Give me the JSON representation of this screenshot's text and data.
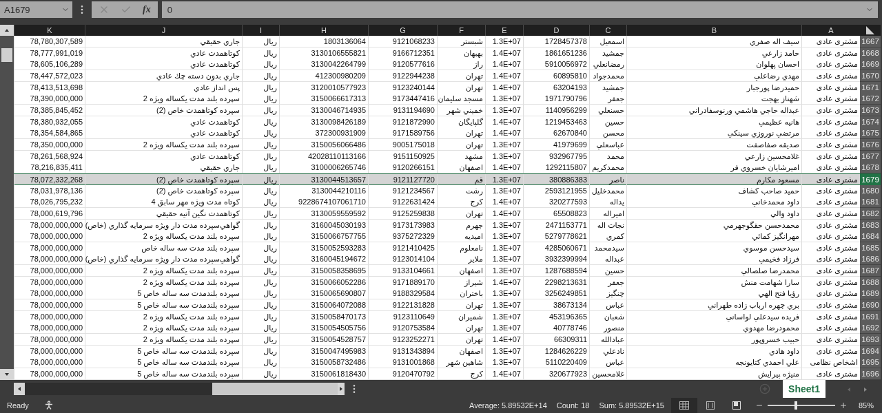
{
  "name_box": "A1679",
  "formula_bar": {
    "function_label": "fx",
    "value": "0"
  },
  "columns": [
    "A",
    "B",
    "C",
    "D",
    "E",
    "F",
    "G",
    "H",
    "I",
    "J",
    "K"
  ],
  "rows": [
    {
      "number": "1667",
      "selected": false,
      "cells": [
        "مشتری عادی",
        "سيف اله صفري",
        "اسمعيل",
        "1728457378",
        "1.3E+07",
        "شبستر",
        "9121068233",
        "1803136064",
        "ريال",
        "جاري حقيقي",
        "78,780,307,589"
      ]
    },
    {
      "number": "1668",
      "selected": false,
      "cells": [
        "مشتری عادی",
        "حامد زارعي",
        "جمشيد",
        "1861651236",
        "1.4E+07",
        "بهبهان",
        "9166712351",
        "3130106555821",
        "ريال",
        "كوتاهمدت عادي",
        "78,777,991,019"
      ]
    },
    {
      "number": "1669",
      "selected": false,
      "cells": [
        "مشتری عادی",
        "احسان پهلوان",
        "رمضانعلي",
        "5910056972",
        "1.4E+07",
        "راز",
        "9120577616",
        "3130042264799",
        "ريال",
        "كوتاهمدت عادي",
        "78,605,106,289"
      ]
    },
    {
      "number": "1670",
      "selected": false,
      "cells": [
        "مشتری عادی",
        "مهدي رضاعلي",
        "محمدجواد",
        "60895810",
        "1.4E+07",
        "تهران",
        "9122944238",
        "412300980209",
        "ريال",
        "جاري بدون دسته چك عادي",
        "78,447,572,023"
      ]
    },
    {
      "number": "1671",
      "selected": false,
      "cells": [
        "مشتری عادی",
        "حميدرضا پورجبار",
        "جمشيد",
        "63204193",
        "1.4E+07",
        "تهران",
        "9123240144",
        "3120010577923",
        "ريال",
        "پس انداز عادي",
        "78,413,513,698"
      ]
    },
    {
      "number": "1672",
      "selected": false,
      "cells": [
        "مشتری عادی",
        "شهناز بهجت",
        "جعفر",
        "1971790796",
        "1.3E+07",
        "مسجد سليمان",
        "9173447416",
        "3150066617313",
        "ريال",
        "سپرده بلند مدت يكساله ويژه 2",
        "78,390,000,000"
      ]
    },
    {
      "number": "1673",
      "selected": false,
      "cells": [
        "مشتری عادی",
        "عبداله حاجي هاشمي ورنوسفادراني",
        "حسنعلي",
        "1140956299",
        "1.3E+07",
        "خميني شهر",
        "9131194690",
        "3130046714935",
        "ريال",
        "سپرده كوتاهمدت خاص (2)",
        "78,385,845,452"
      ]
    },
    {
      "number": "1674",
      "selected": false,
      "cells": [
        "مشتری عادی",
        "هانيه عظيمي",
        "حسين",
        "1219453463",
        "1.4E+07",
        "گلپايگان",
        "9121872990",
        "3130098426189",
        "ريال",
        "كوتاهمدت عادي",
        "78,380,932,055"
      ]
    },
    {
      "number": "1675",
      "selected": false,
      "cells": [
        "مشتری عادی",
        "مرتضي نوروزي سينكي",
        "محسن",
        "62670840",
        "1.4E+07",
        "تهران",
        "9171589756",
        "372300931909",
        "ريال",
        "كوتاهمدت عادي",
        "78,354,584,865"
      ]
    },
    {
      "number": "1676",
      "selected": false,
      "cells": [
        "مشتری عادی",
        "صديقه صفاصفت",
        "عباسعلي",
        "41979699",
        "1.3E+07",
        "تهران",
        "9005175018",
        "3150056066486",
        "ريال",
        "سپرده بلند مدت يكساله ويژه 2",
        "78,350,000,000"
      ]
    },
    {
      "number": "1677",
      "selected": false,
      "cells": [
        "مشتری عادی",
        "غلامحسين زارعي",
        "محمد",
        "932967795",
        "1.3E+07",
        "مشهد",
        "9151150925",
        "42028110113166",
        "ريال",
        "كوتاهمدت عادي",
        "78,261,568,924"
      ]
    },
    {
      "number": "1678",
      "selected": false,
      "cells": [
        "مشتری عادی",
        "اميرشايان خسروي فر",
        "محمدكريم",
        "1292115807",
        "1.4E+07",
        "اصفهان",
        "9120266151",
        "3100006265746",
        "ريال",
        "جاري حقيقي",
        "78,216,835,411"
      ]
    },
    {
      "number": "1679",
      "selected": true,
      "cells": [
        "مشتری عادی",
        "مسعود مكارم",
        "ناصر",
        "380886383",
        "1.3E+07",
        "قم",
        "9121127720",
        "3130044513657",
        "ريال",
        "سپرده كوتاهمدت خاص (2)",
        "78,072,332,268"
      ]
    },
    {
      "number": "1680",
      "selected": false,
      "cells": [
        "مشتری عادی",
        "حميد صاحب كشاف",
        "محمدخليل",
        "2593121955",
        "1.3E+07",
        "رشت",
        "9121234567",
        "3130044210116",
        "ريال",
        "سپرده كوتاهمدت خاص (2)",
        "78,031,978,136"
      ]
    },
    {
      "number": "1681",
      "selected": false,
      "cells": [
        "مشتری عادی",
        "داود محمدخاني",
        "يداله",
        "320277593",
        "1.4E+07",
        "كرج",
        "9122631424",
        "9228674107061710",
        "ريال",
        "كوتاه مدت ويژه مهر سابق 4",
        "78,026,795,232"
      ]
    },
    {
      "number": "1682",
      "selected": false,
      "cells": [
        "مشتری عادی",
        "داود والي",
        "اميراله",
        "65508823",
        "1.4E+07",
        "تهران",
        "9125259838",
        "3130059559592",
        "ريال",
        "كوتاهمدت نگين آتيه حقيقي",
        "78,000,619,796"
      ]
    },
    {
      "number": "1683",
      "selected": false,
      "cells": [
        "مشتری عادی",
        "محمدحسن حقگوجهرمي",
        "نجات اله",
        "2471153771",
        "1.3E+07",
        "جهرم",
        "9173173983",
        "3160045030193",
        "ريال",
        "گواهي‌سپرده  مدت دار ويژه سرمايه گذاري (خاص)",
        "78,000,000,000"
      ]
    },
    {
      "number": "1684",
      "selected": false,
      "cells": [
        "مشتری عادی",
        "مهرانگيز كمائي",
        "كمري",
        "5279778621",
        "1.3E+07",
        "اميديه",
        "9375272329",
        "3150066757755",
        "ريال",
        "سپرده بلند مدت يكساله ويژه 2",
        "78,000,000,000"
      ]
    },
    {
      "number": "1685",
      "selected": false,
      "cells": [
        "مشتری عادی",
        "سيدحسن موسوي",
        "سيدمحمد",
        "4285060671",
        "1.3E+07",
        "نامعلوم",
        "9121410425",
        "3150052593283",
        "ريال",
        "سپرده بلند مدت سه ساله خاص",
        "78,000,000,000"
      ]
    },
    {
      "number": "1686",
      "selected": false,
      "cells": [
        "مشتری عادی",
        "فرزاد فخيمي",
        "عبداله",
        "3932399994",
        "1.3E+07",
        "ملاير",
        "9123014104",
        "3160045194672",
        "ريال",
        "گواهي‌سپرده  مدت دار ويژه سرمايه گذاري (خاص)",
        "78,000,000,000"
      ]
    },
    {
      "number": "1687",
      "selected": false,
      "cells": [
        "مشتری عادی",
        "محمدرضا صلصالي",
        "حسين",
        "1287688594",
        "1.3E+07",
        "اصفهان",
        "9133104661",
        "3150058358695",
        "ريال",
        "سپرده بلند مدت يكساله ويژه 2",
        "78,000,000,000"
      ]
    },
    {
      "number": "1688",
      "selected": false,
      "cells": [
        "مشتری عادی",
        "سارا شهامت منش",
        "جعفر",
        "2298213631",
        "1.4E+07",
        "شيراز",
        "9171889170",
        "3150066052286",
        "ريال",
        "سپرده بلند مدت يكساله ويژه 2",
        "78,000,000,000"
      ]
    },
    {
      "number": "1689",
      "selected": false,
      "cells": [
        "مشتری عادی",
        "رؤيا فتح الهي",
        "چنگيز",
        "3256249851",
        "1.3E+07",
        "باختران",
        "9188329584",
        "3150065690807",
        "ريال",
        "سپرده بلندمدت سه ساله خاص 5",
        "78,000,000,000"
      ]
    },
    {
      "number": "1690",
      "selected": false,
      "cells": [
        "مشتری عادی",
        "بري چهره ارباب زاده طهراني",
        "عباس",
        "38673134",
        "1.3E+07",
        "تهران",
        "9122131828",
        "3150064072088",
        "ريال",
        "سپرده بلندمدت سه ساله خاص 5",
        "78,000,000,000"
      ]
    },
    {
      "number": "1691",
      "selected": false,
      "cells": [
        "مشتری عادی",
        "فريده سيدعلي لواساني",
        "شعبان",
        "453196365",
        "1.3E+07",
        "شميران",
        "9123110649",
        "3150058470173",
        "ريال",
        "سپرده بلند مدت يكساله ويژه 2",
        "78,000,000,000"
      ]
    },
    {
      "number": "1692",
      "selected": false,
      "cells": [
        "مشتری عادی",
        "محمودرضا مهدوي",
        "منصور",
        "40778746",
        "1.3E+07",
        "تهران",
        "9120753584",
        "3150054505756",
        "ريال",
        "سپرده بلند مدت يكساله ويژه 2",
        "78,000,000,000"
      ]
    },
    {
      "number": "1693",
      "selected": false,
      "cells": [
        "مشتری عادی",
        "حبيب خسروپور",
        "عبادالله",
        "66309311",
        "1.4E+07",
        "تهران",
        "9123252271",
        "3150054528757",
        "ريال",
        "سپرده بلند مدت يكساله ويژه 2",
        "78,000,000,000"
      ]
    },
    {
      "number": "1694",
      "selected": false,
      "cells": [
        "مشتری عادی",
        "داود هادي",
        "نادعلي",
        "1284626229",
        "1.3E+07",
        "اصفهان",
        "9131343894",
        "3150047495983",
        "ريال",
        "سپرده بلندمدت سه ساله خاص 5",
        "78,000,000,000"
      ]
    },
    {
      "number": "1695",
      "selected": false,
      "cells": [
        "اشخاص نظامی",
        "علي احمدي كتايونجه",
        "عباس",
        "5110220409",
        "1.3E+07",
        "شاهين شهر",
        "9131001868",
        "3150058732486",
        "ريال",
        "سپرده بلندمدت سه ساله خاص 5",
        "78,000,000,000"
      ]
    },
    {
      "number": "1696",
      "selected": false,
      "cells": [
        "مشتری عادی",
        "منيژه پيرايش",
        "غلامحسين",
        "320677923",
        "1.4E+07",
        "كرج",
        "9120470792",
        "3150061818430",
        "ريال",
        "سپرده بلندمدت سه ساله خاص 5",
        "78,000,000,000"
      ]
    }
  ],
  "sheet_tabs": [
    {
      "label": "Sheet1",
      "selected": true
    }
  ],
  "status_bar": {
    "mode": "Ready",
    "average": "Average: 5.89532E+14",
    "count": "Count: 18",
    "sum": "Sum: 5.89532E+15",
    "views": [
      {
        "kind": "normal",
        "selected": true
      },
      {
        "kind": "page-layout",
        "selected": false
      },
      {
        "kind": "page-break",
        "selected": false
      }
    ],
    "zoom_slider": {
      "level": 0.42
    },
    "zoom": "85%"
  }
}
